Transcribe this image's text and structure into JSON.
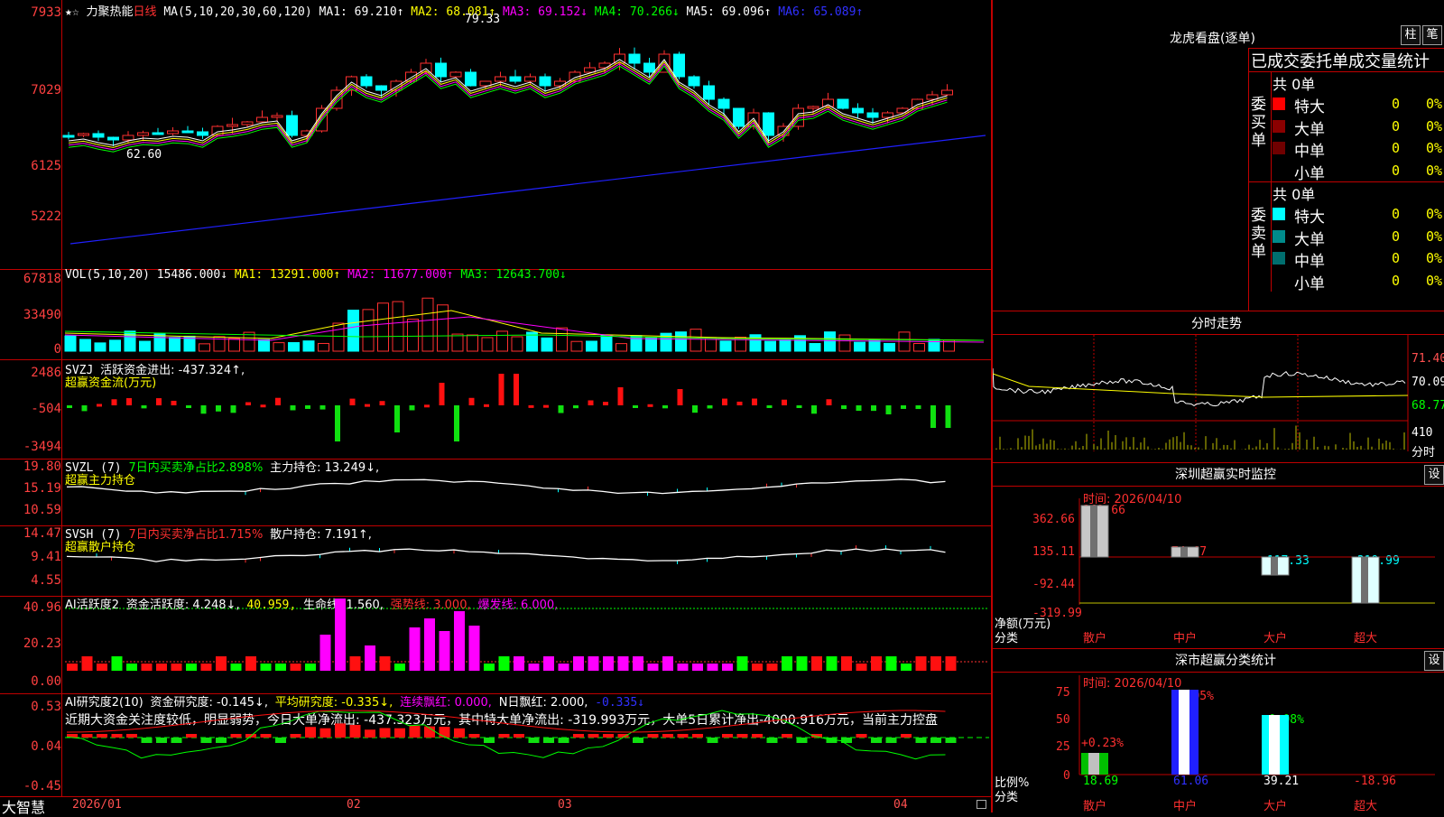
{
  "main": {
    "top_axis_label": "7933",
    "axis": [
      "7029",
      "6125",
      "5222"
    ],
    "title_star": "★☆",
    "instrument": "力聚热能",
    "period": "日线",
    "ma_header": "MA(5,10,20,30,60,120)",
    "ma1": "MA1: 69.210↑",
    "ma2": "MA2: 68.081↑",
    "ma3": "MA3: 69.152↓",
    "ma4": "MA4: 70.266↓",
    "ma5": "MA5: 69.096↑",
    "ma6": "MA6: 65.089↑",
    "high_label": "79.33",
    "low_label": "62.60"
  },
  "vol": {
    "axis": [
      "67818",
      "33490",
      "0"
    ],
    "header": "VOL(5,10,20)",
    "v": "15486.000↓",
    "ma1": "MA1: 13291.000↑",
    "ma2": "MA2: 11677.000↑",
    "ma3": "MA3: 12643.700↓"
  },
  "svzj": {
    "axis": [
      "2486",
      "-504",
      "-3494"
    ],
    "line1_name": "SVZJ",
    "line1_label": "活跃资金进出: -437.324↑,",
    "line2": "超赢资金流(万元)"
  },
  "svzl": {
    "axis": [
      "19.80",
      "15.19",
      "10.59"
    ],
    "name": "SVZL (7)",
    "ratio": "7日内买卖净占比2.898%",
    "hold": "主力持仓: 13.249↓,",
    "line2": "超赢主力持仓"
  },
  "svsh": {
    "axis": [
      "14.47",
      "9.41",
      "4.55"
    ],
    "name": "SVSH (7)",
    "ratio": "7日内买卖净占比1.715%",
    "hold": "散户持仓: 7.191↑,",
    "line2": "超赢散户持仓"
  },
  "ai1": {
    "axis": [
      "40.96",
      "20.23",
      "0.00"
    ],
    "name": "AI活跃度2",
    "a": "资金活跃度: 4.248↓,",
    "b": "40.959,",
    "c": "生命线: 1.560,",
    "d": "强势线: 3.000,",
    "e": "爆发线: 6.000,"
  },
  "ai2": {
    "axis": [
      "0.53",
      "0.04",
      "-0.45"
    ],
    "name": "AI研究度2(10)",
    "a": "资金研究度: -0.145↓,",
    "b": "平均研究度: -0.335↓,",
    "c": "连续飘红: 0.000,",
    "d": "N日飘红: 2.000,",
    "e": "-0.335↓",
    "note": "近期大资金关注度较低，明显弱势，今日大单净流出: -437.323万元，其中特大单净流出: -319.993万元，大单5日累计净出-4000.916万元，当前主力控盘"
  },
  "bottom": {
    "brand": "大智慧",
    "dates": [
      "2026/01",
      "02",
      "03",
      "04"
    ]
  },
  "dragon": {
    "title": "龙虎看盘(逐单)",
    "btn1": "柱",
    "btn2": "笔",
    "tabs": "已成交委托单成交量统计",
    "buy_label": "委买单",
    "sell_label": "委卖单",
    "buy_total": "共 0单",
    "sell_total": "共 0单",
    "rows": [
      {
        "name": "特大",
        "val": "0",
        "pct": "0%"
      },
      {
        "name": "大单",
        "val": "0",
        "pct": "0%"
      },
      {
        "name": "中单",
        "val": "0",
        "pct": "0%"
      },
      {
        "name": "小单",
        "val": "0",
        "pct": "0%"
      }
    ],
    "buy_colors": [
      "#ff0000",
      "#8b0000",
      "#700000"
    ],
    "sell_colors": [
      "#00ffff",
      "#008b8b",
      "#006e6e"
    ]
  },
  "fenshi": {
    "title": "分时走势",
    "axis": [
      "71.40",
      "70.09",
      "68.77"
    ],
    "vol_axis": [
      "410",
      "分时"
    ]
  },
  "sz_monitor": {
    "title": "深圳超赢实时监控",
    "btn": "设",
    "time": "时间: 2026/04/10",
    "axis": [
      "362.66",
      "135.11",
      "-92.44",
      "-319.99"
    ],
    "ylabel": "净额(万元)",
    "xlabel": "分类",
    "cats": [
      "散户",
      "中户",
      "大户",
      "超大"
    ],
    "vals": [
      "362.66",
      "74.67",
      "-117.33",
      "-319.99"
    ]
  },
  "sz_class": {
    "title": "深市超赢分类统计",
    "btn": "设",
    "time": "时间: 2026/04/10",
    "axis": [
      "75",
      "50",
      "25",
      "0"
    ],
    "ylabel": "比例%",
    "xlabel": "分类",
    "cats": [
      "散户",
      "中户",
      "大户",
      "超大"
    ],
    "vals": [
      "18.69",
      "61.06",
      "39.21",
      "-18.96"
    ],
    "deltas": [
      "+0.23%",
      "+0.05%",
      "-0.08%"
    ]
  },
  "chart_data": {
    "type": "bar",
    "title": "深圳超赢实时监控",
    "categories": [
      "散户",
      "中户",
      "大户",
      "超大"
    ],
    "series": [
      {
        "name": "净额(万元)",
        "values": [
          362.66,
          74.67,
          -117.33,
          -319.99
        ]
      },
      {
        "name": "比例%",
        "values": [
          18.69,
          61.06,
          39.21,
          -18.96
        ]
      }
    ]
  }
}
